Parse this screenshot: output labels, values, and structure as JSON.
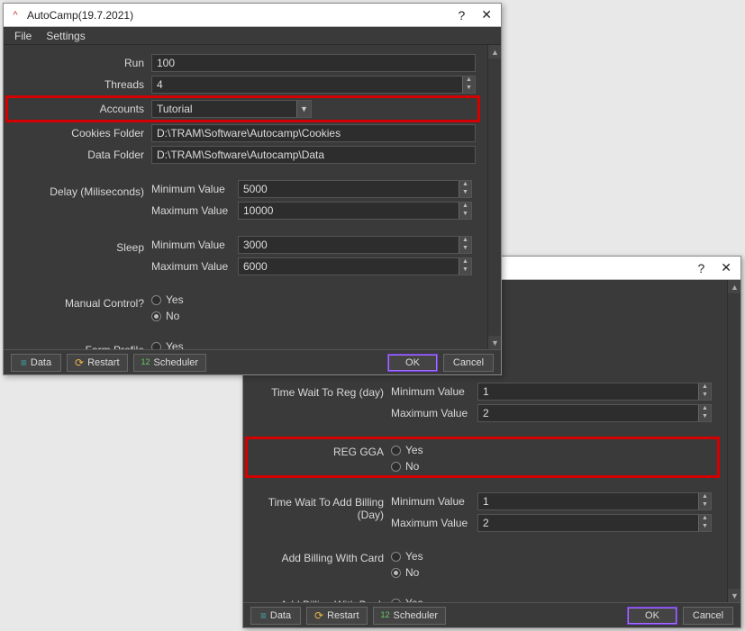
{
  "window1": {
    "title": "AutoCamp(19.7.2021)",
    "help": "?",
    "close": "✕",
    "menus": {
      "file": "File",
      "settings": "Settings"
    },
    "labels": {
      "run": "Run",
      "threads": "Threads",
      "accounts": "Accounts",
      "cookies_folder": "Cookies Folder",
      "data_folder": "Data Folder",
      "delay": "Delay (Miliseconds)",
      "sleep": "Sleep",
      "manual_control": "Manual Control?",
      "farm_profile": "Farm Profile",
      "min": "Minimum Value",
      "max": "Maximum Value",
      "yes": "Yes",
      "no": "No"
    },
    "values": {
      "run": "100",
      "threads": "4",
      "accounts": "Tutorial",
      "cookies_folder": "D:\\TRAM\\Software\\Autocamp\\Cookies",
      "data_folder": "D:\\TRAM\\Software\\Autocamp\\Data",
      "delay_min": "5000",
      "delay_max": "10000",
      "sleep_min": "3000",
      "sleep_max": "6000",
      "manual_control": "No",
      "farm_profile": "No"
    },
    "footer": {
      "data": "Data",
      "restart": "Restart",
      "scheduler": "Scheduler",
      "ok": "OK",
      "cancel": "Cancel"
    }
  },
  "window2": {
    "help": "?",
    "close": "✕",
    "labels": {
      "time_wait_reg": "Time Wait To Reg (day)",
      "reg_gga": "REG GGA",
      "time_wait_billing": "Time Wait To Add Billing (Day)",
      "add_billing_card": "Add Billing With Card",
      "add_billing_bank": "Add Billing With Bank",
      "min": "Minimum Value",
      "max": "Maximum Value",
      "yes": "Yes",
      "no": "No"
    },
    "values": {
      "reg_min": "1",
      "reg_max": "2",
      "reg_gga": "",
      "billing_min": "1",
      "billing_max": "2",
      "add_billing_card": "No",
      "add_billing_bank": "No"
    },
    "footer": {
      "data": "Data",
      "restart": "Restart",
      "scheduler": "Scheduler",
      "ok": "OK",
      "cancel": "Cancel"
    }
  }
}
